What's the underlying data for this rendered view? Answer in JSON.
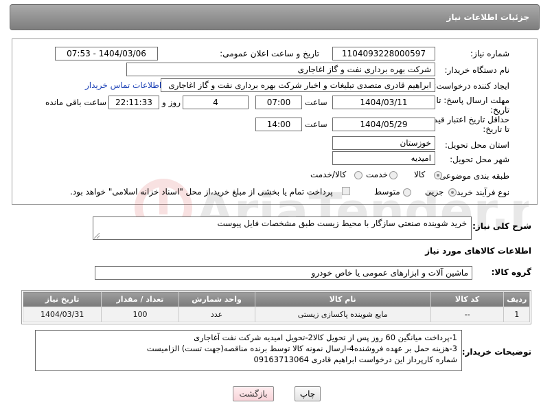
{
  "header": {
    "title": "جزئیات اطلاعات نیاز"
  },
  "form": {
    "need_number": {
      "label": "شماره نیاز:",
      "value": "1104093228000597"
    },
    "announce_datetime": {
      "label": "تاریخ و ساعت اعلان عمومی:",
      "value": "1404/03/06 - 07:53"
    },
    "buyer_org": {
      "label": "نام دستگاه خریدار:",
      "value": "شرکت بهره برداری نفت و گاز اغاجاری"
    },
    "requester": {
      "label": "ایجاد کننده درخواست:",
      "value": "ابراهیم قادری متصدی تبلیغات و اخبار شرکت بهره برداری نفت و گاز اغاجاری",
      "contact_link": "اطلاعات تماس خریدار"
    },
    "reply_deadline": {
      "label_line1": "مهلت ارسال پاسخ: تا",
      "label_line2": "تاریخ:",
      "date": "1404/03/11",
      "time_label": "ساعت",
      "time": "07:00",
      "days": "4",
      "days_label": "روز و",
      "remaining": "22:11:33",
      "remaining_label": "ساعت باقی مانده"
    },
    "price_validity": {
      "label_line1": "حداقل تاریخ اعتبار قیمت:",
      "label_line2": "تا تاریخ:",
      "date": "1404/05/29",
      "time_label": "ساعت",
      "time": "14:00"
    },
    "province": {
      "label": "استان محل تحویل:",
      "value": "خوزستان"
    },
    "city": {
      "label": "شهر محل تحویل:",
      "value": "امیدیه"
    },
    "category": {
      "label": "طبقه بندی موضوعی:",
      "options": [
        "کالا",
        "خدمت",
        "کالا/خدمت"
      ],
      "selected": "کالا"
    },
    "process": {
      "label": "نوع فرآیند خرید :",
      "options": [
        "جزیی",
        "متوسط"
      ],
      "selected": "جزیی",
      "payment_note": "پرداخت تمام یا بخشی از مبلغ خرید،از محل \"اسناد خزانه اسلامی\" خواهد بود."
    }
  },
  "description": {
    "label": "شرح کلی نیاز:",
    "value": "خرید شوینده صنعتی سازگار با محیط زیست طبق مشخصات فایل پیوست"
  },
  "goods_info": {
    "title": "اطلاعات کالاهای مورد نیاز"
  },
  "goods_group": {
    "label": "گروه کالا:",
    "value": "ماشین آلات و ابزارهای عمومی یا خاص خودرو"
  },
  "table": {
    "headers": [
      "ردیف",
      "کد کالا",
      "نام کالا",
      "واحد شمارش",
      "تعداد / مقدار",
      "تاریخ نیاز"
    ],
    "rows": [
      {
        "row": "1",
        "code": "--",
        "name": "مایع شوینده پاکسازی زیستی",
        "unit": "عدد",
        "qty": "100",
        "date": "1404/03/31"
      }
    ]
  },
  "buyer_notes": {
    "label": "توضیحات خریدار:",
    "lines": [
      "1-پرداخت میانگین 60 روز پس از تحویل کالا2-تحویل امیدیه شرکت نفت آغاجاری",
      "3-هزینه حمل بر عهده فروشنده4-ارسال نمونه کالا توسط برنده مناقصه(جهت تست) الزامیست",
      "شماره کارپرداز این درخواست  ابراهیم قادری 09163713064"
    ]
  },
  "buttons": {
    "print": "چاپ",
    "back": "بازگشت"
  },
  "watermark": {
    "text": "AriaTender.net"
  },
  "colors": {
    "title_bar": "#8f8f8f",
    "link": "#1a3fb5",
    "back_button": "#f7d3d8"
  }
}
